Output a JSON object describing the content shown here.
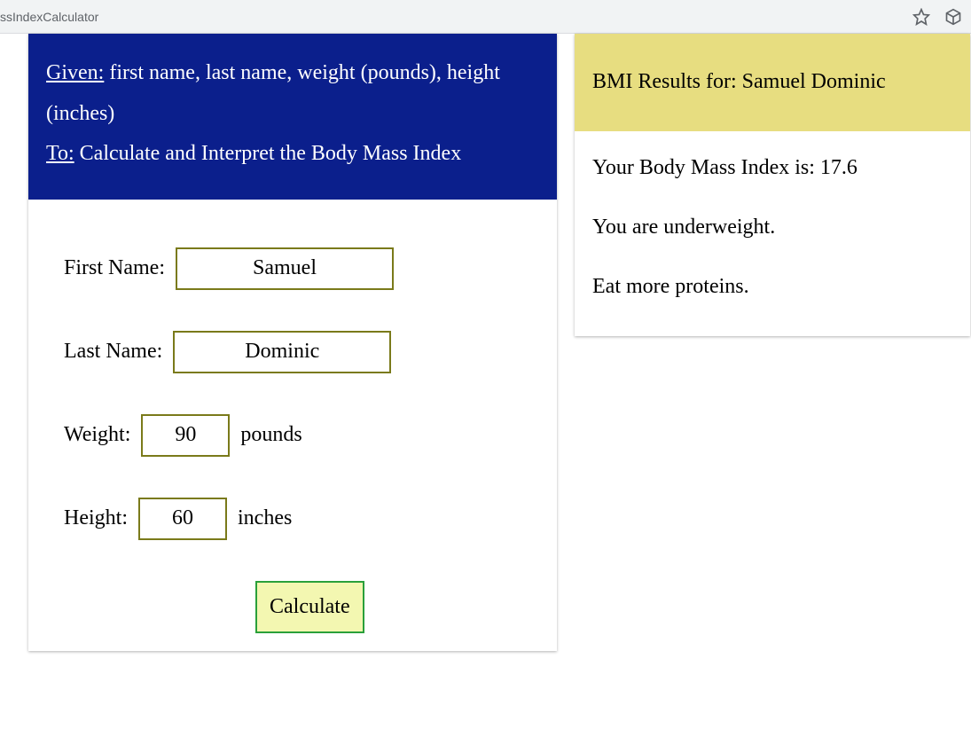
{
  "browser": {
    "url_fragment": "ssIndexCalculator"
  },
  "header": {
    "given_label": "Given:",
    "given_text": " first name, last name, weight (pounds), height (inches)",
    "to_label": "To:",
    "to_text": " Calculate and Interpret the Body Mass Index"
  },
  "form": {
    "first_name_label": "First Name:",
    "first_name_value": "Samuel",
    "last_name_label": "Last Name:",
    "last_name_value": "Dominic",
    "weight_label": "Weight:",
    "weight_value": "90",
    "weight_unit": "pounds",
    "height_label": "Height:",
    "height_value": "60",
    "height_unit": "inches",
    "calculate_label": "Calculate"
  },
  "results": {
    "header_prefix": "BMI Results for: ",
    "full_name": "Samuel Dominic",
    "bmi_line_prefix": "Your Body Mass Index is: ",
    "bmi_value": "17.6",
    "status_line": "You are underweight.",
    "advice_line": "Eat more proteins."
  }
}
